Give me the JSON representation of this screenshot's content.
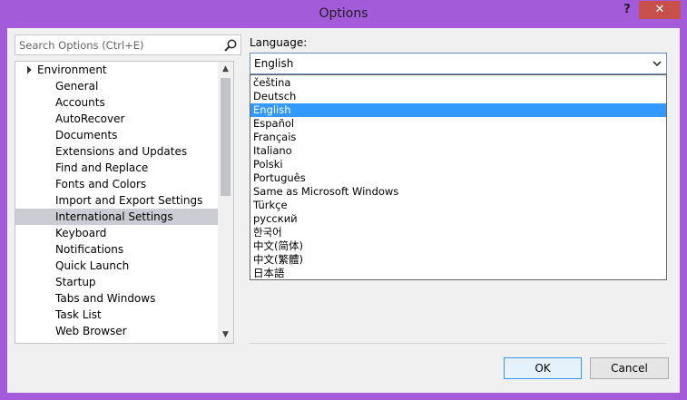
{
  "window": {
    "title": "Options",
    "help_label": "?",
    "close_label": "✕",
    "accent_color": "#a35bd9"
  },
  "search": {
    "placeholder": "Search Options (Ctrl+E)",
    "icon": "search-icon"
  },
  "tree": {
    "root": {
      "label": "Environment",
      "expanded": true
    },
    "items": [
      {
        "label": "General"
      },
      {
        "label": "Accounts"
      },
      {
        "label": "AutoRecover"
      },
      {
        "label": "Documents"
      },
      {
        "label": "Extensions and Updates"
      },
      {
        "label": "Find and Replace"
      },
      {
        "label": "Fonts and Colors"
      },
      {
        "label": "Import and Export Settings"
      },
      {
        "label": "International Settings",
        "selected": true
      },
      {
        "label": "Keyboard"
      },
      {
        "label": "Notifications"
      },
      {
        "label": "Quick Launch"
      },
      {
        "label": "Startup"
      },
      {
        "label": "Tabs and Windows"
      },
      {
        "label": "Task List"
      },
      {
        "label": "Web Browser"
      }
    ]
  },
  "language": {
    "label": "Language:",
    "selected": "English",
    "options": [
      "čeština",
      "Deutsch",
      "English",
      "Español",
      "Français",
      "Italiano",
      "Polski",
      "Português",
      "Same as Microsoft Windows",
      "Türkçe",
      "русский",
      "한국어",
      "中文(简体)",
      "中文(繁體)",
      "日本語"
    ],
    "selected_index": 2,
    "highlight_color": "#3399ff"
  },
  "buttons": {
    "ok": "OK",
    "cancel": "Cancel"
  }
}
